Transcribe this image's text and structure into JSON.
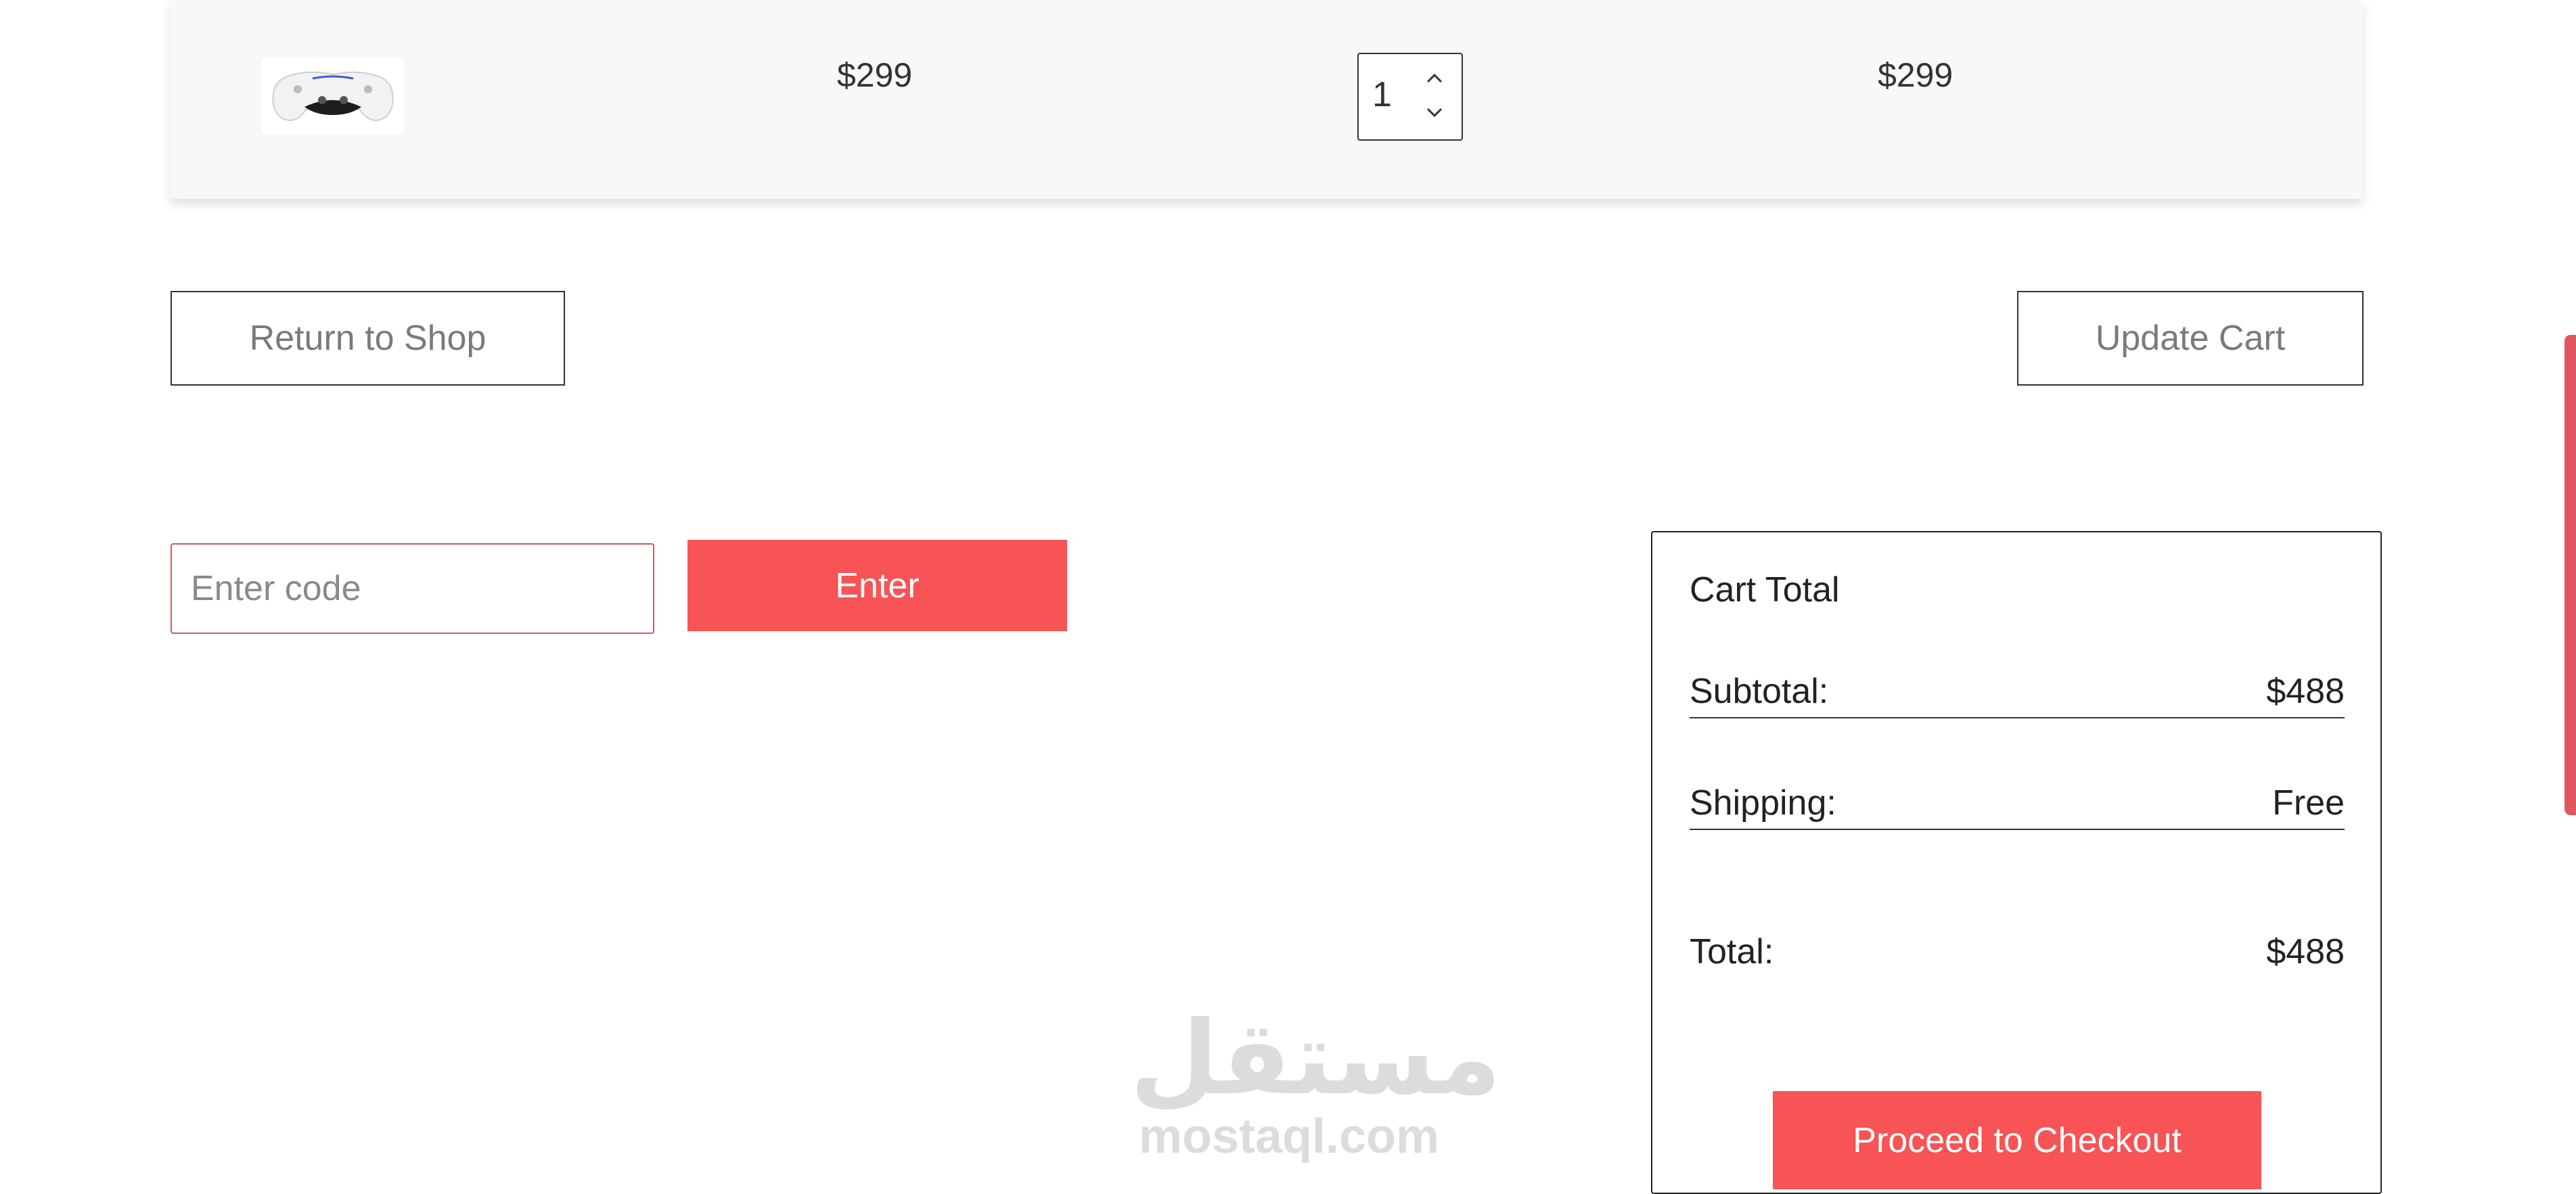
{
  "cart": {
    "item": {
      "image_icon": "game-controller",
      "price": "$299",
      "quantity": "1",
      "subtotal": "$299"
    }
  },
  "actions": {
    "return_label": "Return to Shop",
    "update_label": "Update Cart"
  },
  "coupon": {
    "placeholder": "Enter code",
    "value": "",
    "button_label": "Enter"
  },
  "cart_total": {
    "title": "Cart Total",
    "subtotal_label": "Subtotal:",
    "subtotal_value": "$488",
    "shipping_label": "Shipping:",
    "shipping_value": "Free",
    "total_label": "Total:",
    "total_value": "$488",
    "checkout_label": "Proceed to Checkout"
  },
  "watermark": {
    "arabic": "مستقل",
    "latin": "mostaql.com"
  },
  "colors": {
    "accent": "#f85355",
    "scrollbar": "#e05561"
  }
}
